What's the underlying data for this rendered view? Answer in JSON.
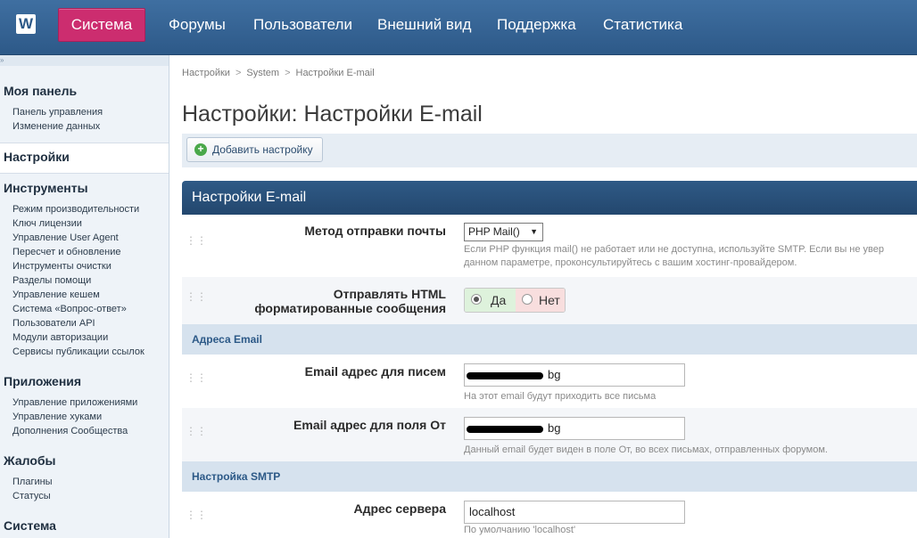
{
  "app": {
    "logo_letter": "W"
  },
  "nav": {
    "tabs": [
      {
        "label": "Система",
        "active": true
      },
      {
        "label": "Форумы",
        "active": false
      },
      {
        "label": "Пользователи",
        "active": false
      },
      {
        "label": "Внешний вид",
        "active": false
      },
      {
        "label": "Поддержка",
        "active": false
      },
      {
        "label": "Статистика",
        "active": false
      }
    ]
  },
  "sidebar": {
    "strip_marker": "»",
    "dashboard": {
      "heading": "Моя панель",
      "items": [
        "Панель управления",
        "Изменение данных"
      ]
    },
    "settings_heading": "Настройки",
    "tools": {
      "heading": "Инструменты",
      "items": [
        "Режим производительности",
        "Ключ лицензии",
        "Управление User Agent",
        "Пересчет и обновление",
        "Инструменты очистки",
        "Разделы помощи",
        "Управление кешем",
        "Система «Вопрос-ответ»",
        "Пользователи API",
        "Модули авторизации",
        "Сервисы публикации ссылок"
      ]
    },
    "apps": {
      "heading": "Приложения",
      "items": [
        "Управление приложениями",
        "Управление хуками",
        "Дополнения Сообщества"
      ]
    },
    "complaints": {
      "heading": "Жалобы",
      "items": [
        "Плагины",
        "Статусы"
      ]
    },
    "system_heading": "Система"
  },
  "breadcrumb": {
    "items": [
      "Настройки",
      "System",
      "Настройки E-mail"
    ],
    "separator": ">"
  },
  "page": {
    "title": "Настройки: Настройки E-mail",
    "add_button": "Добавить настройку"
  },
  "panel": {
    "title": "Настройки E-mail",
    "mail_method": {
      "label": "Метод отправки почты",
      "value": "PHP Mail()",
      "hint_line1": "Если PHP функция mail() не работает или не доступна, используйте SMTP. Если вы не увер",
      "hint_line2": "данном параметре, проконсультируйтесь с вашим хостинг-провайдером."
    },
    "html_mail": {
      "label_line1": "Отправлять HTML",
      "label_line2": "форматированные сообщения",
      "yes": "Да",
      "no": "Нет",
      "selected": "yes"
    },
    "email_section": "Адреса Email",
    "email_to": {
      "label": "Email адрес для писем",
      "value_suffix": "bg",
      "hint": "На этот email будут приходить все письма"
    },
    "email_from": {
      "label": "Email адрес для поля От",
      "value_suffix": "bg",
      "hint": "Данный email будет виден в поле От, во всех письмах, отправленных форумом."
    },
    "smtp_section": "Настройка SMTP",
    "server": {
      "label": "Адрес сервера",
      "value": "localhost",
      "hint": "По умолчанию 'localhost'"
    }
  },
  "colors": {
    "header": "#2d5988",
    "active_tab": "#cc2d6f",
    "section_bg": "#d6e2ee",
    "radio_yes_bg": "#def2dc",
    "radio_no_bg": "#f8dede"
  }
}
